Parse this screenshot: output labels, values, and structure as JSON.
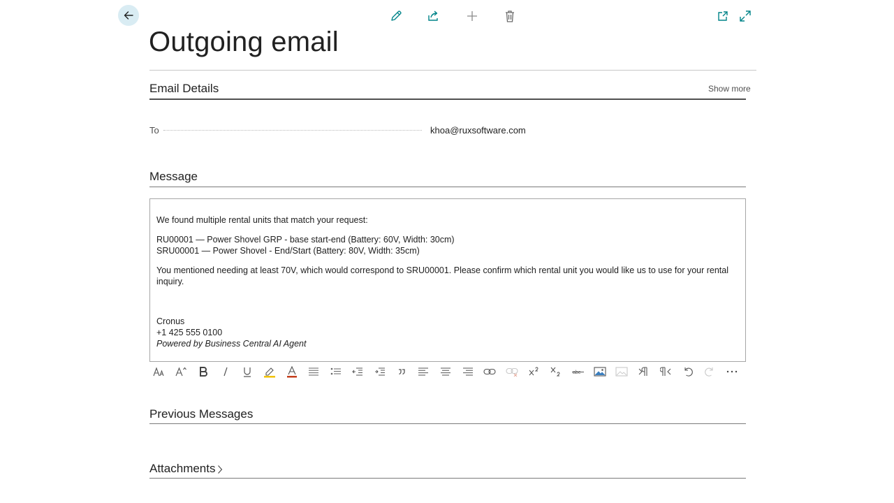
{
  "header": {
    "page_title": "Outgoing email"
  },
  "email_details": {
    "section_title": "Email Details",
    "show_more_label": "Show more",
    "to_label": "To",
    "to_value": "khoa@ruxsoftware.com"
  },
  "message": {
    "section_title": "Message",
    "intro": "We found multiple rental units that match your request:",
    "unit_1": "RU00001 — Power Shovel GRP - base start-end (Battery: 60V, Width: 30cm)",
    "unit_2": "SRU00001 — Power Shovel - End/Start (Battery: 80V, Width: 35cm)",
    "body": "You mentioned needing at least 70V, which would correspond to SRU00001. Please confirm which rental unit you would like us to use for your rental inquiry.",
    "signature_name": "Cronus",
    "signature_phone": "+1 425 555 0100",
    "signature_powered": "Powered by Business Central AI Agent"
  },
  "previous_messages": {
    "section_title": "Previous Messages"
  },
  "attachments": {
    "section_title": "Attachments"
  },
  "colors": {
    "accent": "#008489",
    "back_button_bg": "#d9ecf3",
    "highlight_yellow": "#f2c200",
    "font_color_red": "#c43e1c"
  },
  "icons": {
    "top_toolbar": [
      "edit-icon",
      "share-icon",
      "add-icon",
      "delete-icon"
    ],
    "window": [
      "open-in-new-window-icon",
      "expand-icon"
    ],
    "editor_toolbar": [
      "font-icon",
      "font-size-icon",
      "bold-icon",
      "italic-icon",
      "underline-icon",
      "highlight-icon",
      "font-color-icon",
      "bullets-icon",
      "numbering-icon",
      "decrease-indent-icon",
      "increase-indent-icon",
      "quote-icon",
      "align-left-icon",
      "align-center-icon",
      "align-right-icon",
      "link-icon",
      "unlink-icon",
      "superscript-icon",
      "subscript-icon",
      "strikethrough-icon",
      "insert-image-icon",
      "remove-image-icon",
      "ltr-icon",
      "rtl-icon",
      "undo-icon",
      "redo-icon",
      "more-icon"
    ]
  }
}
